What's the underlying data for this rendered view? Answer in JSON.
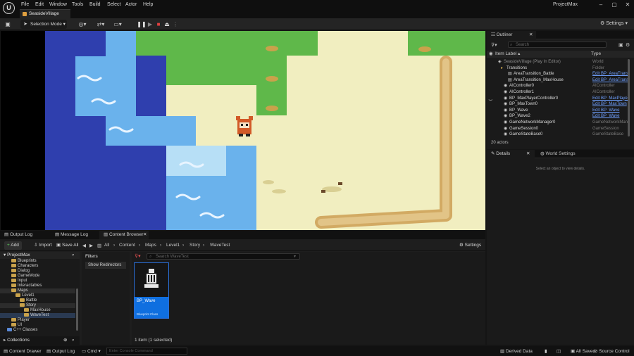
{
  "titlebar": {
    "level_tab": "SeasideVillage",
    "menus": [
      "File",
      "Edit",
      "Window",
      "Tools",
      "Build",
      "Select",
      "Actor",
      "Help"
    ],
    "project_name": "ProjectMax",
    "window_buttons": [
      "–",
      "▢",
      "✕"
    ]
  },
  "toolbar": {
    "selection_mode": "Selection Mode",
    "settings": "Settings"
  },
  "outliner": {
    "tab": "Outliner",
    "search_placeholder": "Search",
    "col_label": "Item Label ▴",
    "col_type": "Type",
    "rows": [
      {
        "label": "SeasideVillage (Play In Editor)",
        "type": "World",
        "link": false
      },
      {
        "label": "Transitions",
        "type": "Folder",
        "link": false
      },
      {
        "label": "AreaTransition_Battle",
        "type": "Edit BP_AreaTrans",
        "link": true
      },
      {
        "label": "AreaTransition_MaxHouse",
        "type": "Edit BP_AreaTrans",
        "link": true
      },
      {
        "label": "AIController0",
        "type": "AIController",
        "link": false
      },
      {
        "label": "AIController1",
        "type": "AIController",
        "link": false
      },
      {
        "label": "BP_MaxPlayerController0",
        "type": "Edit BP_MaxPlayer",
        "link": true
      },
      {
        "label": "BP_MaxTown0",
        "type": "Edit BP_MaxTown",
        "link": true
      },
      {
        "label": "BP_Wave",
        "type": "Edit BP_Wave",
        "link": true
      },
      {
        "label": "BP_Wave2",
        "type": "Edit BP_Wave",
        "link": true
      },
      {
        "label": "GameNetworkManager0",
        "type": "GameNetworkMan",
        "link": false
      },
      {
        "label": "GameSession0",
        "type": "GameSession",
        "link": false
      },
      {
        "label": "GameStateBase0",
        "type": "GameStateBase",
        "link": false
      }
    ],
    "count": "20 actors"
  },
  "details": {
    "tab_details": "Details",
    "tab_world": "World Settings",
    "empty_msg": "Select an object to view details."
  },
  "bottom": {
    "tabs": [
      "Output Log",
      "Message Log",
      "Content Browser"
    ],
    "add": "Add",
    "import": "Import",
    "save_all": "Save All",
    "breadcrumb": [
      "All",
      "Content",
      "Maps",
      "Level1",
      "Story",
      "WaveTest"
    ],
    "settings": "Settings",
    "tree_root": "ProjectMax",
    "tree": [
      {
        "label": "Blueprints",
        "depth": 1
      },
      {
        "label": "Characters",
        "depth": 1
      },
      {
        "label": "Dialog",
        "depth": 1
      },
      {
        "label": "GameMode",
        "depth": 1
      },
      {
        "label": "Input",
        "depth": 1
      },
      {
        "label": "Interactables",
        "depth": 1
      },
      {
        "label": "Maps",
        "depth": 1
      },
      {
        "label": "Level1",
        "depth": 2
      },
      {
        "label": "Battle",
        "depth": 3
      },
      {
        "label": "Story",
        "depth": 3
      },
      {
        "label": "MaxHouse",
        "depth": 4
      },
      {
        "label": "WaveTest",
        "depth": 4
      },
      {
        "label": "Player",
        "depth": 1
      },
      {
        "label": "UI",
        "depth": 1
      },
      {
        "label": "C++ Classes",
        "depth": 0
      }
    ],
    "collections": "Collections",
    "filters_title": "Filters",
    "filter_item": "Show Redirectors",
    "asset_search_placeholder": "Search WaveTest",
    "asset_name": "BP_Wave",
    "asset_type": "Blueprint Class",
    "item_count": "1 item (1 selected)"
  },
  "statusbar": {
    "content_drawer": "Content Drawer",
    "output_log": "Output Log",
    "cmd": "Cmd",
    "console_placeholder": "Enter Console Command",
    "derived_data": "Derived Data",
    "all_saved": "All Saved",
    "source_control": "Source Control"
  }
}
